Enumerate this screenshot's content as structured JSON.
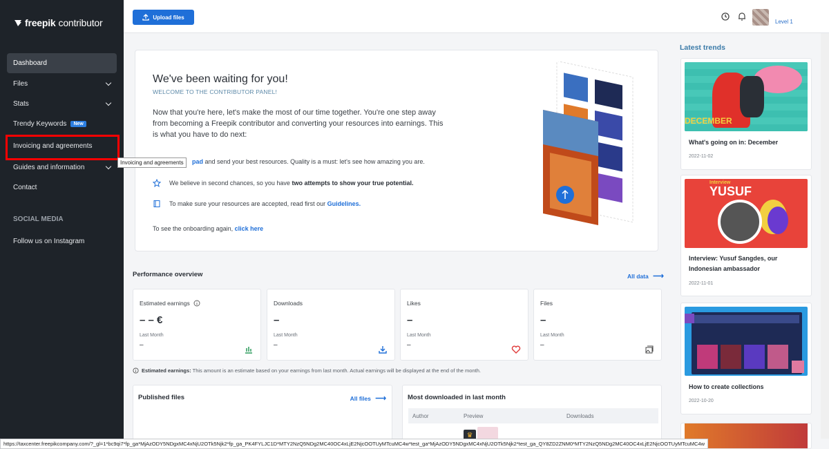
{
  "sidebar": {
    "logo": {
      "bold": "freepik",
      "light": "contributor"
    },
    "items": [
      {
        "label": "Dashboard"
      },
      {
        "label": "Files"
      },
      {
        "label": "Stats"
      },
      {
        "label": "Trendy Keywords",
        "badge": "New"
      },
      {
        "label": "Invoicing and agreements"
      },
      {
        "label": "Guides and information"
      },
      {
        "label": "Contact"
      }
    ],
    "social_heading": "SOCIAL MEDIA",
    "instagram": "Follow us on Instagram",
    "tooltip": "Invoicing and agreements"
  },
  "topbar": {
    "upload_label": "Upload files",
    "level": "Level 1"
  },
  "welcome": {
    "title": "We've been waiting for you!",
    "subtitle": "WELCOME TO THE CONTRIBUTOR PANEL!",
    "intro": "Now that you're here, let's make the most of our time together. You're one step away from becoming a Freepik contributor and converting your resources into earnings. This is what you have to do next:",
    "step1_link": "pad",
    "step1": " and send your best resources. Quality is a must: let's see how amazing you are.",
    "step2_a": "We believe in second chances, so you have ",
    "step2_b": "two attempts to show your true potential.",
    "step3_a": "To make sure your resources are accepted, read first our ",
    "step3_link": "Guidelines.",
    "onboarding": "To see the onboarding again, ",
    "onboarding_link": "click here"
  },
  "performance": {
    "title": "Performance overview",
    "all_data": "All data",
    "cards": [
      {
        "label": "Estimated earnings",
        "value": "– – €",
        "sub": "Last Month",
        "sub_value": "–"
      },
      {
        "label": "Downloads",
        "value": "–",
        "sub": "Last Month",
        "sub_value": "–"
      },
      {
        "label": "Likes",
        "value": "–",
        "sub": "Last Month",
        "sub_value": "–"
      },
      {
        "label": "Files",
        "value": "–",
        "sub": "Last Month",
        "sub_value": "–"
      }
    ],
    "note_bold": "Estimated earnings:",
    "note": " This amount is an estimate based on your earnings from last month. Actual earnings will be displayed at the end of the month."
  },
  "published": {
    "title": "Published files",
    "link": "All files"
  },
  "most_downloaded": {
    "title": "Most downloaded in last month",
    "columns": [
      "Author",
      "Preview",
      "Downloads"
    ]
  },
  "trends": {
    "title": "Latest trends",
    "items": [
      {
        "title": "What's going on in: December",
        "date": "2022-11-02",
        "img_text": "DECEMBER"
      },
      {
        "title": "Interview: Yusuf Sangdes, our Indonesian ambassador",
        "date": "2022-11-01",
        "img_label": "Interview",
        "img_text": "YUSUF"
      },
      {
        "title": "How to create collections",
        "date": "2022-10-20"
      }
    ]
  },
  "status_url": "https://taxcenter.freepikcompany.com/?_gl=1*bc9qi7*fp_ga*MjAzODY5NDgxMC4xNjU2OTk5Njk2*fp_ga_PK4FYLJC1D*MTY2NzQ5NDg2MC40OC4xLjE2NjcOOTUyMTcuMC4w*test_ga*MjAzODY5NDgxMC4xNjU2OTk5Njk2*test_ga_QY8ZD2ZNM0*MTY2NzQ5NDg2MC40OC4xLjE2NjcOOTUyMTcuMC4w"
}
